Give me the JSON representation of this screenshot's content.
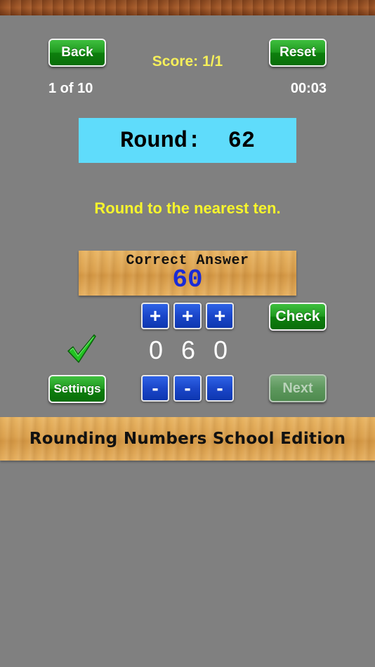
{
  "header": {
    "back_label": "Back",
    "reset_label": "Reset",
    "score": "Score: 1/1",
    "progress": "1 of 10",
    "timer": "00:03"
  },
  "question": {
    "round_text": "Round:  62",
    "instruction": "Round to the nearest ten."
  },
  "answer": {
    "label": "Correct Answer",
    "value": "60"
  },
  "controls": {
    "plus_label": "+",
    "minus_label": "-",
    "digits": [
      "0",
      "6",
      "0"
    ],
    "check_label": "Check",
    "settings_label": "Settings",
    "next_label": "Next",
    "result_icon": "checkmark-icon"
  },
  "footer": {
    "title": "Rounding Numbers School Edition"
  },
  "colors": {
    "background": "#808080",
    "score_text": "#f6ef5a",
    "instruction_text": "#f7f52c",
    "round_box": "#5fdcfb",
    "answer_value": "#1a2bd6"
  }
}
